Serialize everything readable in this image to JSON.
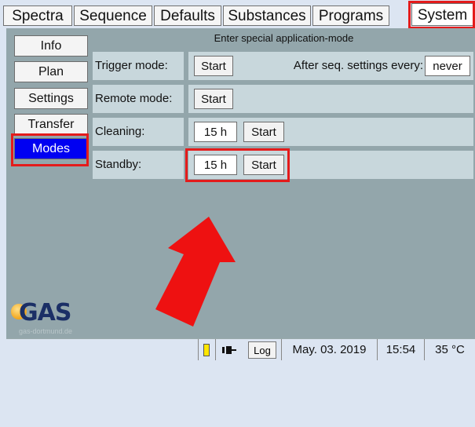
{
  "tabs": [
    "Spectra",
    "Sequence",
    "Defaults",
    "Substances",
    "Programs",
    "System"
  ],
  "active_tab": "System",
  "sidebar": {
    "items": [
      {
        "label": "Info"
      },
      {
        "label": "Plan"
      },
      {
        "label": "Settings"
      },
      {
        "label": "Transfer"
      },
      {
        "label": "Modes"
      }
    ],
    "selected": "Modes"
  },
  "main": {
    "header": "Enter special application-mode",
    "rows": [
      {
        "label": "Trigger mode:",
        "start": "Start",
        "after_label": "After seq. settings every:",
        "after_value": "never"
      },
      {
        "label": "Remote mode:",
        "start": "Start"
      },
      {
        "label": "Cleaning:",
        "hours": "15 h",
        "start": "Start"
      },
      {
        "label": "Standby:",
        "hours": "15 h",
        "start": "Start"
      }
    ]
  },
  "logo": {
    "text": "GAS",
    "sub": "gas-dortmund.de"
  },
  "status": {
    "log": "Log",
    "date": "May. 03. 2019",
    "time": "15:54",
    "temp": "35 °C"
  },
  "colors": {
    "panel": "#93a6ab",
    "row_bg": "#c8d7dc",
    "selected": "#0000f2",
    "highlight": "#e41b1b"
  }
}
